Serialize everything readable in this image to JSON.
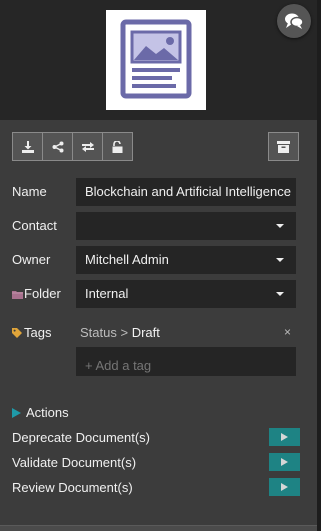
{
  "toolbar": {
    "buttons": [
      {
        "icon": "download-icon"
      },
      {
        "icon": "share-icon"
      },
      {
        "icon": "replace-icon"
      },
      {
        "icon": "unlock-icon"
      }
    ],
    "archive_icon": "archive-icon"
  },
  "fields": {
    "name": {
      "label": "Name",
      "value": "Blockchain and Artificial Intelligence"
    },
    "contact": {
      "label": "Contact",
      "value": ""
    },
    "owner": {
      "label": "Owner",
      "value": "Mitchell Admin"
    },
    "folder": {
      "label": "Folder",
      "value": "Internal",
      "icon": "folder-icon"
    }
  },
  "tags": {
    "label": "Tags",
    "icon": "tag-icon",
    "items": [
      {
        "category": "Status",
        "separator": ">",
        "value": "Draft",
        "remove": "×"
      }
    ],
    "placeholder": "+ Add a tag"
  },
  "actions": {
    "title": "Actions",
    "items": [
      {
        "label": "Deprecate Document(s)"
      },
      {
        "label": "Validate Document(s)"
      },
      {
        "label": "Review Document(s)"
      }
    ]
  },
  "colors": {
    "accent": "#1f9aa8",
    "action_button": "#1e8384",
    "thumbnail_icon": "#6b6aa8",
    "folder_icon": "#a8718e",
    "tag_icon": "#e0a53a"
  }
}
